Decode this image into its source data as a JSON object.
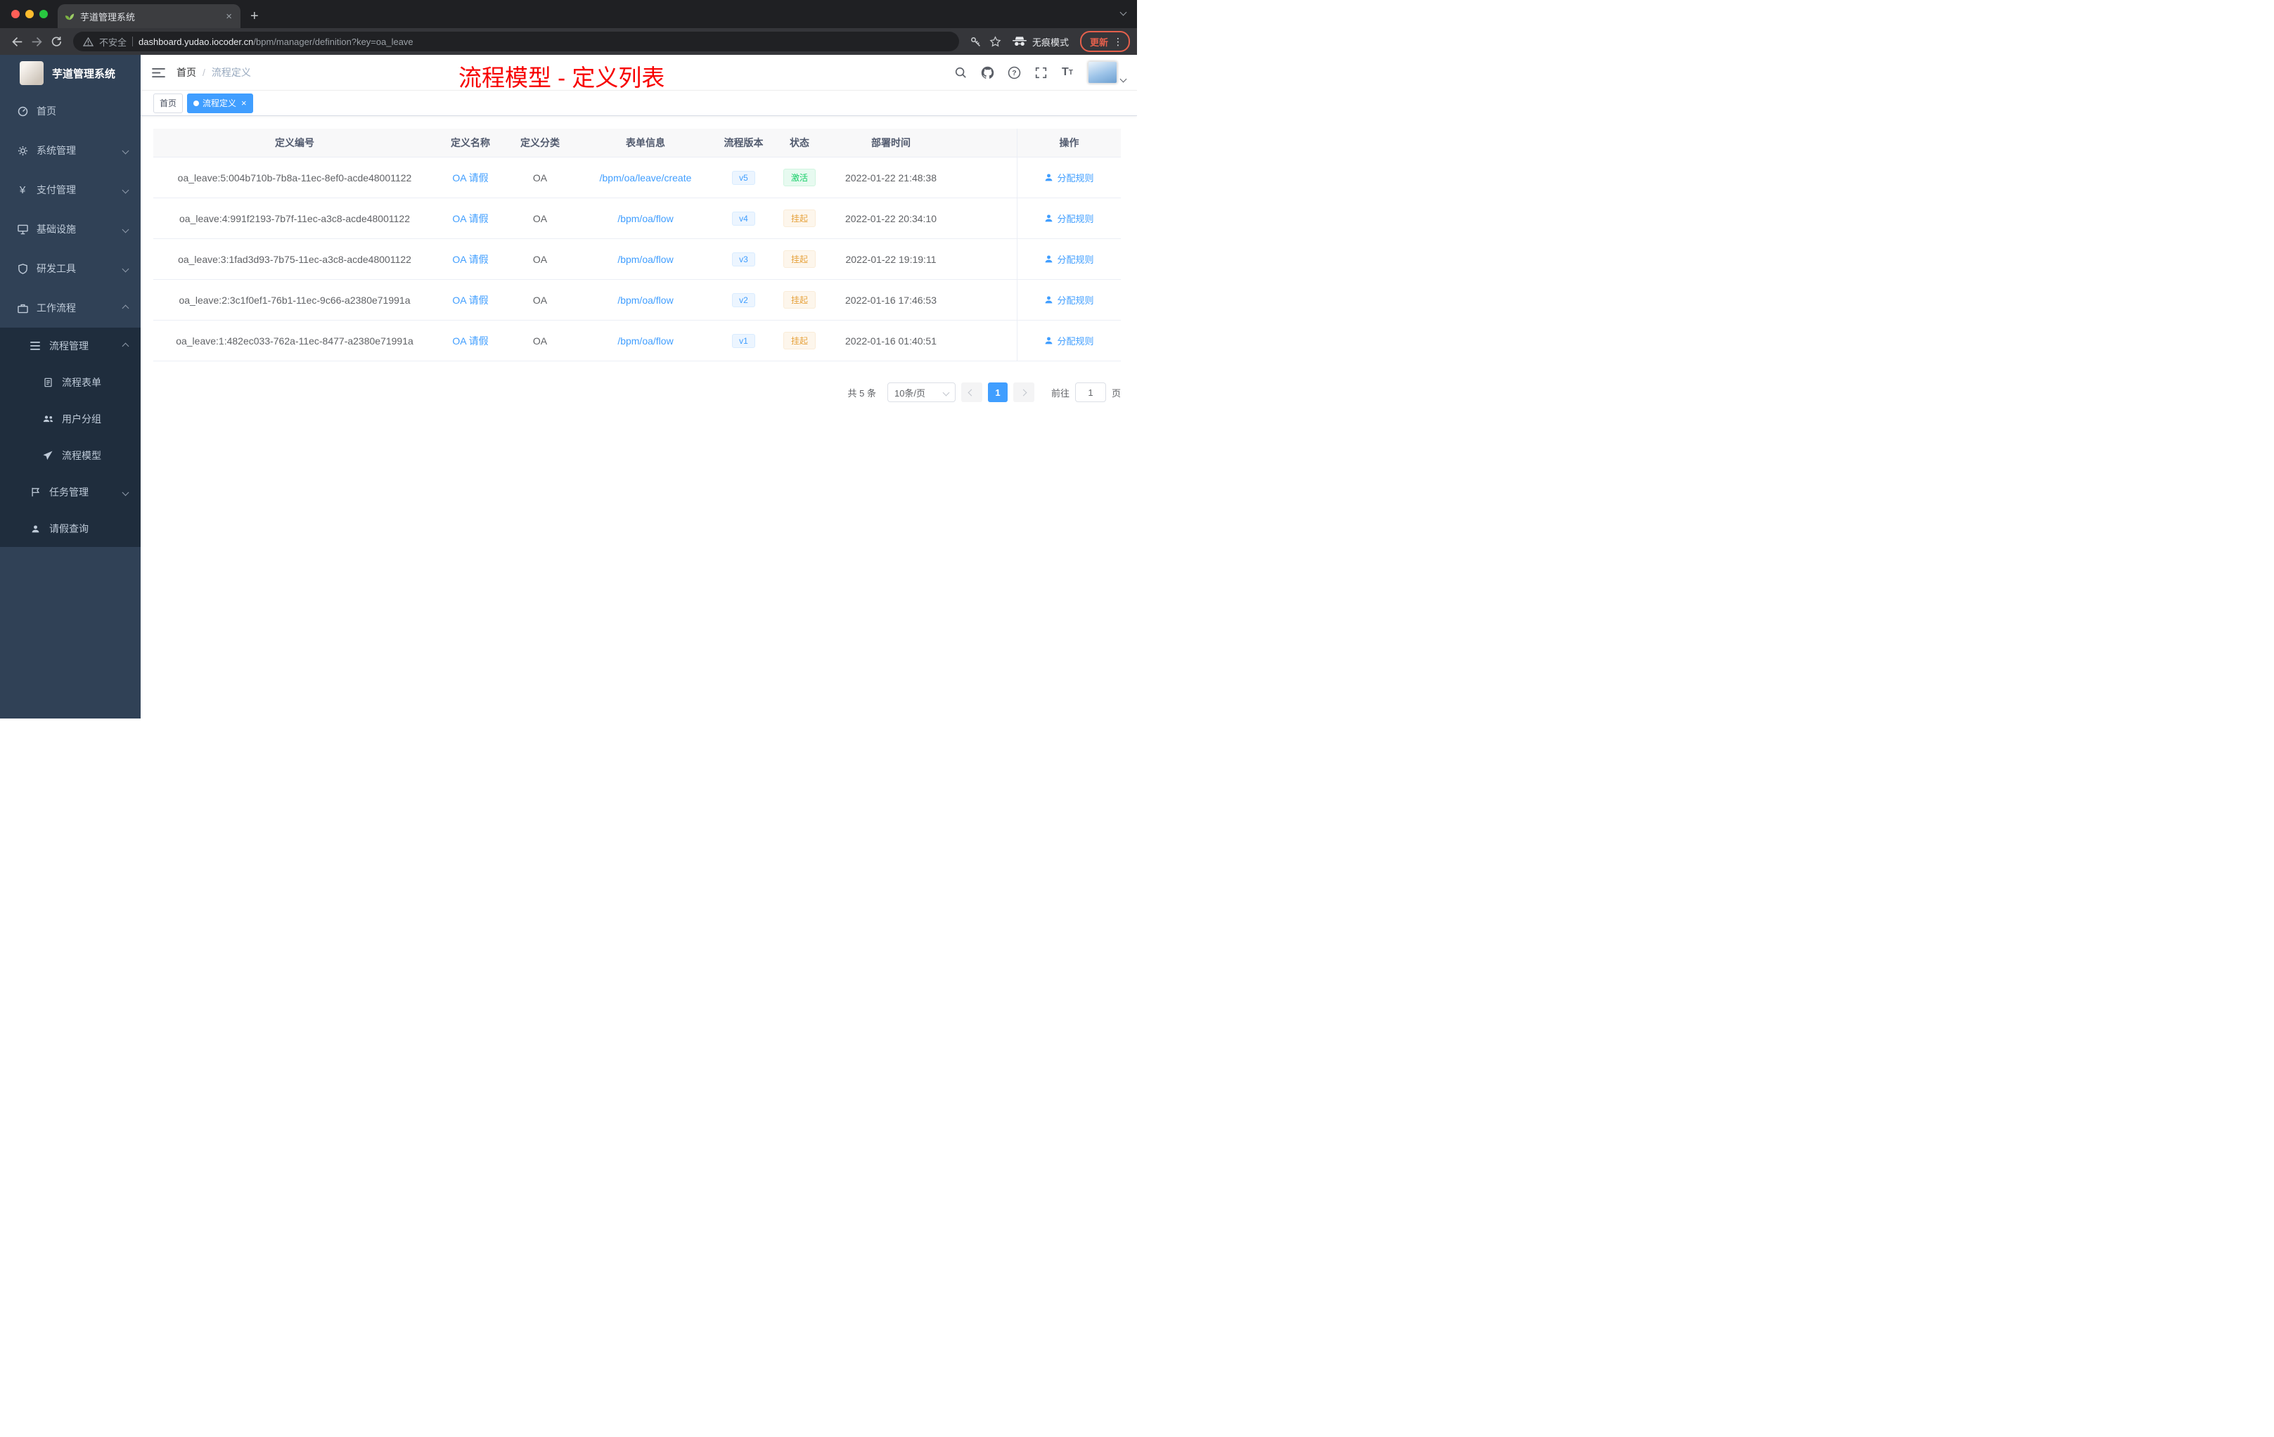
{
  "browser": {
    "tab_title": "芋道管理系统",
    "security_label": "不安全",
    "url_domain": "dashboard.yudao.iocoder.cn",
    "url_path": "/bpm/manager/definition?key=oa_leave",
    "incognito_label": "无痕模式",
    "update_label": "更新"
  },
  "glyphs": {
    "close": "×",
    "new_tab": "+",
    "kebab": "⋮",
    "payment": "¥"
  },
  "sidebar": {
    "logo_title": "芋道管理系统",
    "items": [
      {
        "label": "首页",
        "icon": "dashboard-icon"
      },
      {
        "label": "系统管理",
        "icon": "gear-icon"
      },
      {
        "label": "支付管理",
        "icon": "payment-icon"
      },
      {
        "label": "基础设施",
        "icon": "infrastructure-icon"
      },
      {
        "label": "研发工具",
        "icon": "devtools-icon"
      },
      {
        "label": "工作流程",
        "icon": "workflow-icon"
      },
      {
        "label": "流程管理",
        "icon": "process-manage-icon"
      },
      {
        "label": "流程表单",
        "icon": "form-icon"
      },
      {
        "label": "用户分组",
        "icon": "user-group-icon"
      },
      {
        "label": "流程模型",
        "icon": "process-model-icon"
      },
      {
        "label": "任务管理",
        "icon": "task-icon"
      },
      {
        "label": "请假查询",
        "icon": "user-icon"
      }
    ]
  },
  "header": {
    "breadcrumb_home": "首页",
    "breadcrumb_separator": "/",
    "breadcrumb_current": "流程定义",
    "annotation": "流程模型 - 定义列表"
  },
  "tags": {
    "home": "首页",
    "active": "流程定义"
  },
  "table": {
    "columns": [
      "定义编号",
      "定义名称",
      "定义分类",
      "表单信息",
      "流程版本",
      "状态",
      "部署时间",
      "操作"
    ],
    "rows": [
      {
        "id": "oa_leave:5:004b710b-7b8a-11ec-8ef0-acde48001122",
        "name": "OA 请假",
        "category": "OA",
        "form": "/bpm/oa/leave/create",
        "version": "v5",
        "status": "激活",
        "time": "2022-01-22 21:48:38",
        "action": "分配规则"
      },
      {
        "id": "oa_leave:4:991f2193-7b7f-11ec-a3c8-acde48001122",
        "name": "OA 请假",
        "category": "OA",
        "form": "/bpm/oa/flow",
        "version": "v4",
        "status": "挂起",
        "time": "2022-01-22 20:34:10",
        "action": "分配规则"
      },
      {
        "id": "oa_leave:3:1fad3d93-7b75-11ec-a3c8-acde48001122",
        "name": "OA 请假",
        "category": "OA",
        "form": "/bpm/oa/flow",
        "version": "v3",
        "status": "挂起",
        "time": "2022-01-22 19:19:11",
        "action": "分配规则"
      },
      {
        "id": "oa_leave:2:3c1f0ef1-76b1-11ec-9c66-a2380e71991a",
        "name": "OA 请假",
        "category": "OA",
        "form": "/bpm/oa/flow",
        "version": "v2",
        "status": "挂起",
        "time": "2022-01-16 17:46:53",
        "action": "分配规则"
      },
      {
        "id": "oa_leave:1:482ec033-762a-11ec-8477-a2380e71991a",
        "name": "OA 请假",
        "category": "OA",
        "form": "/bpm/oa/flow",
        "version": "v1",
        "status": "挂起",
        "time": "2022-01-16 01:40:51",
        "action": "分配规则"
      }
    ]
  },
  "pagination": {
    "total": "共 5 条",
    "page_size": "10条/页",
    "current_page": "1",
    "goto_label": "前往",
    "goto_value": "1",
    "page_unit": "页"
  },
  "colors": {
    "accent": "#409eff",
    "success_text": "#13ce66",
    "warning_text": "#e6a23c",
    "annotation": "#f70000",
    "sidebar_bg": "#304156",
    "submenu_bg": "#1f2d3d"
  }
}
